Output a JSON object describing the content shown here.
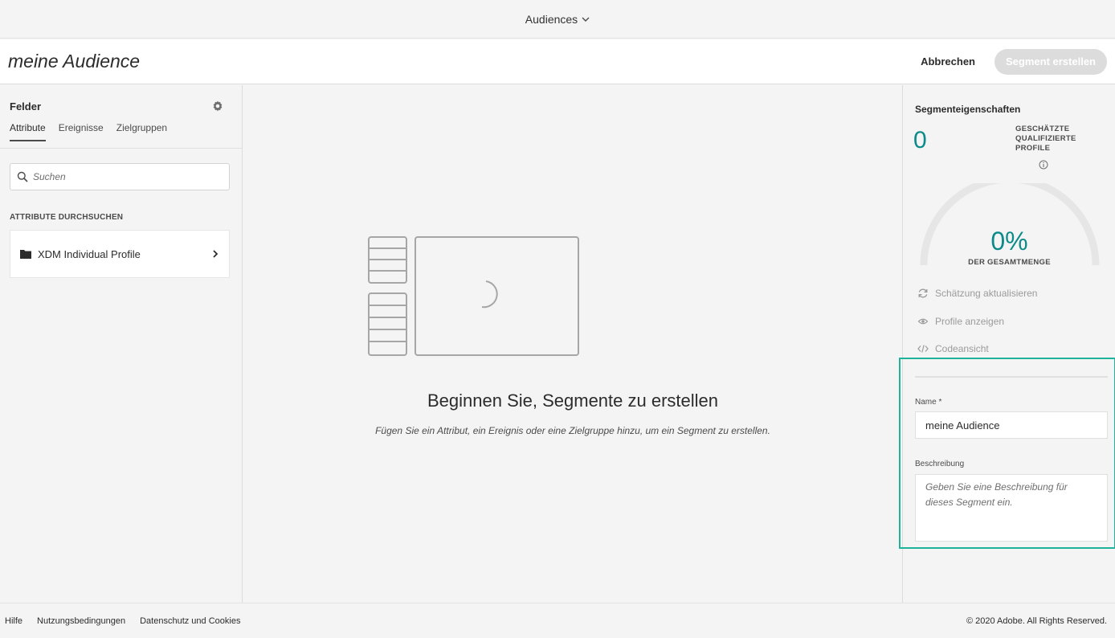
{
  "topbar": {
    "title": "Audiences",
    "chevron_icon": "chevron-down-icon"
  },
  "header": {
    "title": "meine Audience",
    "cancel_label": "Abbrechen",
    "create_label": "Segment erstellen"
  },
  "left_panel": {
    "title": "Felder",
    "settings_icon": "gear-icon",
    "tabs": [
      {
        "label": "Attribute",
        "active": true
      },
      {
        "label": "Ereignisse",
        "active": false
      },
      {
        "label": "Zielgruppen",
        "active": false
      }
    ],
    "search": {
      "placeholder": "Suchen",
      "icon": "search-icon"
    },
    "section_label": "ATTRIBUTE DURCHSUCHEN",
    "items": [
      {
        "label": "XDM Individual Profile",
        "icon": "folder-icon"
      }
    ]
  },
  "center": {
    "title": "Beginnen Sie, Segmente zu erstellen",
    "subtitle": "Fügen Sie ein Attribut, ein Ereignis oder eine Zielgruppe hinzu, um ein Segment zu erstellen."
  },
  "right_panel": {
    "title": "Segmenteigenschaften",
    "count": "0",
    "count_label": "GESCHÄTZTE QUALIFIZIERTE PROFILE",
    "percent": "0%",
    "percent_value": 0,
    "percent_label": "DER GESAMTMENGE",
    "actions": [
      {
        "label": "Schätzung aktualisieren",
        "icon": "refresh-icon"
      },
      {
        "label": "Profile anzeigen",
        "icon": "eye-icon"
      },
      {
        "label": "Codeansicht",
        "icon": "code-icon"
      }
    ],
    "name_label": "Name *",
    "name_value": "meine Audience",
    "description_label": "Beschreibung",
    "description_placeholder": "Geben Sie eine Beschreibung für dieses Segment ein."
  },
  "footer": {
    "links": [
      "Hilfe",
      "Nutzungsbedingungen",
      "Datenschutz und Cookies"
    ],
    "copyright": "© 2020 Adobe. All Rights Reserved."
  },
  "colors": {
    "accent": "#0d8a8a",
    "highlight": "#1fb39c",
    "disabled_button": "#dcdcdc"
  }
}
